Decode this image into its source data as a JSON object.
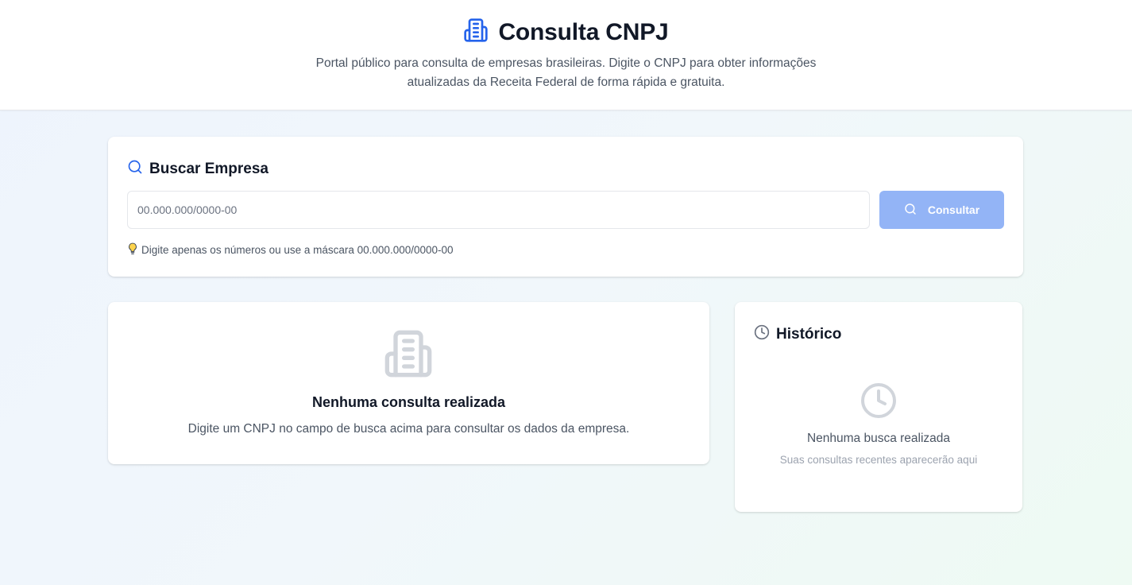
{
  "header": {
    "title": "Consulta CNPJ",
    "subtitle": "Portal público para consulta de empresas brasileiras. Digite o CNPJ para obter informações atualizadas da Receita Federal de forma rápida e gratuita.",
    "icon": "building-icon"
  },
  "search": {
    "heading": "Buscar Empresa",
    "placeholder": "00.000.000/0000-00",
    "value": "",
    "button_label": "Consultar",
    "hint": "Digite apenas os números ou use a máscara 00.000.000/0000-00"
  },
  "results": {
    "empty_title": "Nenhuma consulta realizada",
    "empty_text": "Digite um CNPJ no campo de busca acima para consultar os dados da empresa."
  },
  "history": {
    "heading": "Histórico",
    "empty_title": "Nenhuma busca realizada",
    "empty_sub": "Suas consultas recentes aparecerão aqui"
  },
  "colors": {
    "accent": "#2563eb",
    "button_disabled": "#93b4f6",
    "muted_icon": "#d1d5db"
  }
}
